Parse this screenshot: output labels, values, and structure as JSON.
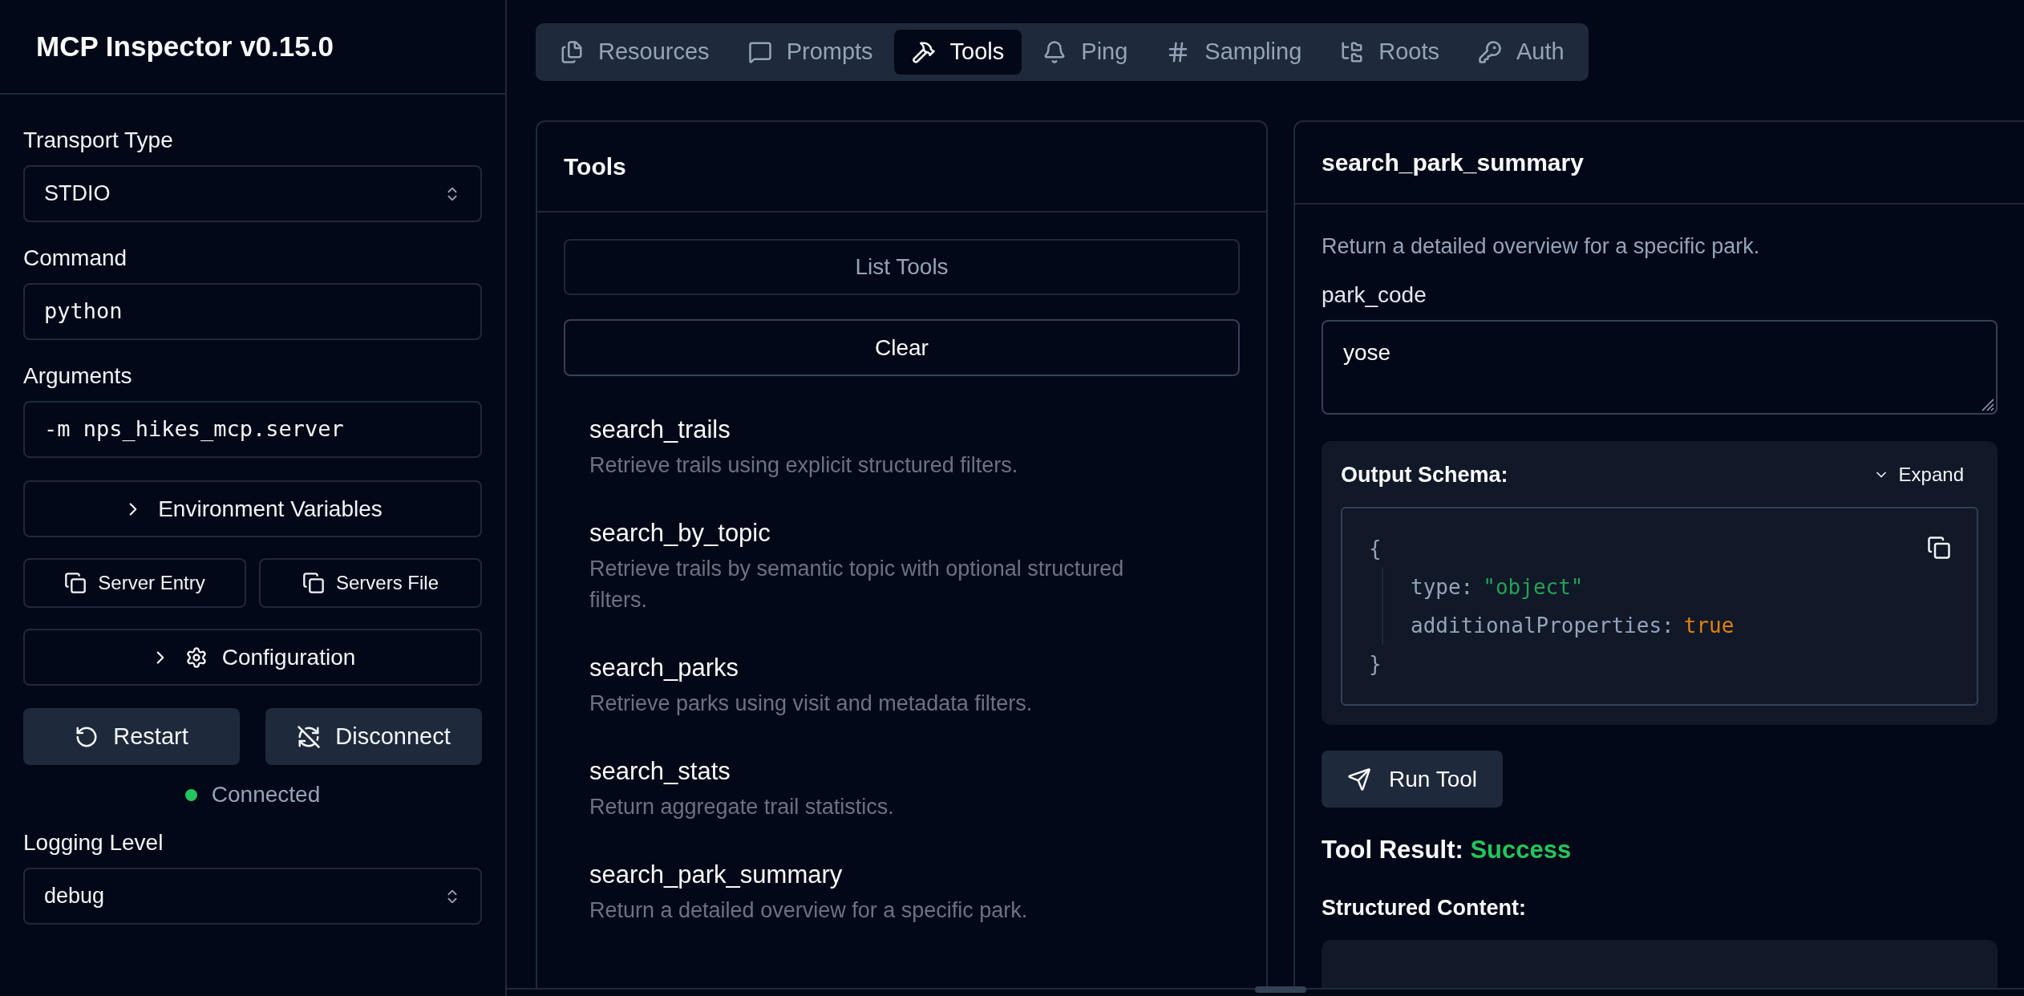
{
  "app_title": "MCP Inspector v0.15.0",
  "sidebar": {
    "transport": {
      "label": "Transport Type",
      "value": "STDIO"
    },
    "command": {
      "label": "Command",
      "value": "python"
    },
    "arguments": {
      "label": "Arguments",
      "value": "-m nps_hikes_mcp.server"
    },
    "env_button": "Environment Variables",
    "copy_buttons": [
      "Server Entry",
      "Servers File"
    ],
    "config_button": "Configuration",
    "restart_button": "Restart",
    "disconnect_button": "Disconnect",
    "status": {
      "label": "Connected",
      "connected": true
    },
    "logging": {
      "label": "Logging Level",
      "value": "debug"
    }
  },
  "tabs": [
    {
      "label": "Resources",
      "selected": false
    },
    {
      "label": "Prompts",
      "selected": false
    },
    {
      "label": "Tools",
      "selected": true
    },
    {
      "label": "Ping",
      "selected": false
    },
    {
      "label": "Sampling",
      "selected": false
    },
    {
      "label": "Roots",
      "selected": false
    },
    {
      "label": "Auth",
      "selected": false
    }
  ],
  "tools_panel": {
    "title": "Tools",
    "list_button": "List Tools",
    "clear_button": "Clear",
    "items": [
      {
        "name": "search_trails",
        "description": "Retrieve trails using explicit structured filters."
      },
      {
        "name": "search_by_topic",
        "description": "Retrieve trails by semantic topic with optional structured filters."
      },
      {
        "name": "search_parks",
        "description": "Retrieve parks using visit and metadata filters."
      },
      {
        "name": "search_stats",
        "description": "Return aggregate trail statistics."
      },
      {
        "name": "search_park_summary",
        "description": "Return a detailed overview for a specific park."
      }
    ]
  },
  "detail_panel": {
    "title": "search_park_summary",
    "description": "Return a detailed overview for a specific park.",
    "params": [
      {
        "label": "park_code",
        "value": "yose"
      }
    ],
    "output_schema": {
      "title": "Output Schema:",
      "toggle": "Expand",
      "open": "{",
      "close": "}",
      "properties": [
        {
          "key": "type:",
          "value": "\"object\"",
          "kind": "string"
        },
        {
          "key": "additionalProperties:",
          "value": "true",
          "kind": "boolean"
        }
      ]
    },
    "run_button": "Run Tool",
    "result": {
      "label": "Tool Result:",
      "status": "Success",
      "kind": "success"
    },
    "structured_heading": "Structured Content:"
  }
}
